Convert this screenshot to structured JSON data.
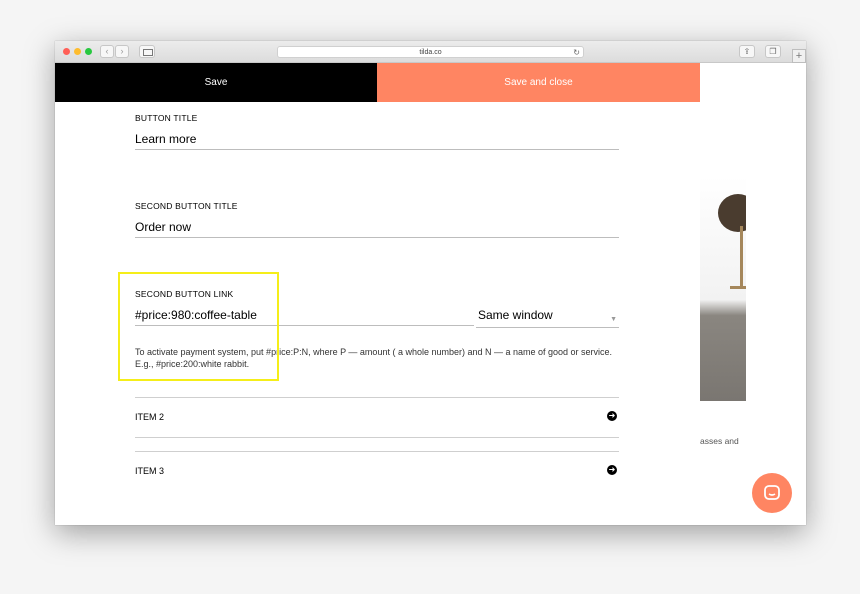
{
  "browser": {
    "url": "tilda.co",
    "back_glyph": "‹",
    "forward_glyph": "›",
    "reload_glyph": "↻",
    "newtab_glyph": "+"
  },
  "toolbar": {
    "save_label": "Save",
    "save_close_label": "Save and close"
  },
  "form": {
    "button_title": {
      "label": "BUTTON TITLE",
      "value": "Learn more"
    },
    "second_button_title": {
      "label": "SECOND BUTTON TITLE",
      "value": "Order now"
    },
    "second_button_link": {
      "label": "SECOND BUTTON LINK",
      "value": "#price:980:coffee-table",
      "target_selected": "Same window"
    },
    "hint": "To activate payment system, put #price:P:N, where P — amount ( a whole number) and N — a name of good or service. E.g., #price:200:white rabbit."
  },
  "items": [
    {
      "label": "ITEM 2"
    },
    {
      "label": "ITEM 3"
    }
  ],
  "background_page": {
    "visible_text": "asses and"
  },
  "colors": {
    "accent": "#ff8562",
    "save_bg": "#000000",
    "highlight": "#f5ee19"
  },
  "icons": {
    "item_arrow": "arrow-right-circle-icon",
    "chat": "chat-bubble-icon"
  }
}
